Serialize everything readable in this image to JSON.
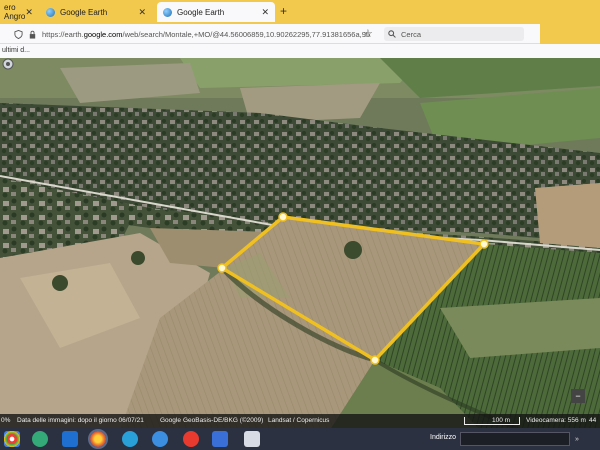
{
  "browser": {
    "tabs": [
      {
        "label": "ero Angro"
      },
      {
        "label": "Google Earth"
      },
      {
        "label": "Google Earth"
      }
    ],
    "new_tab": "+",
    "url_prefix": "https://earth.",
    "url_host": "google.com",
    "url_rest": "/web/search/Montale,+MO/@44.56006859,10.90262295,77.91381656a,95",
    "search_placeholder": "Cerca",
    "bookmark": "ultimi d..."
  },
  "map": {
    "status_zoom": "0%",
    "imagery_date": "Data delle immagini: dopo il giorno 06/07/21",
    "attribution_1": "Google",
    "attribution_2": "GeoBasis-DE/BKG (©2009)",
    "attribution_3": "Landsat / Copernicus",
    "scale_label": "100 m",
    "camera": "Videocamera: 556 m",
    "camera_tail": "44",
    "tool_minus": "−"
  },
  "taskbar": {
    "address_label": "Indirizzo"
  },
  "colors": {
    "tabbar": "#f2c94c",
    "polygon": "#f0c020"
  }
}
